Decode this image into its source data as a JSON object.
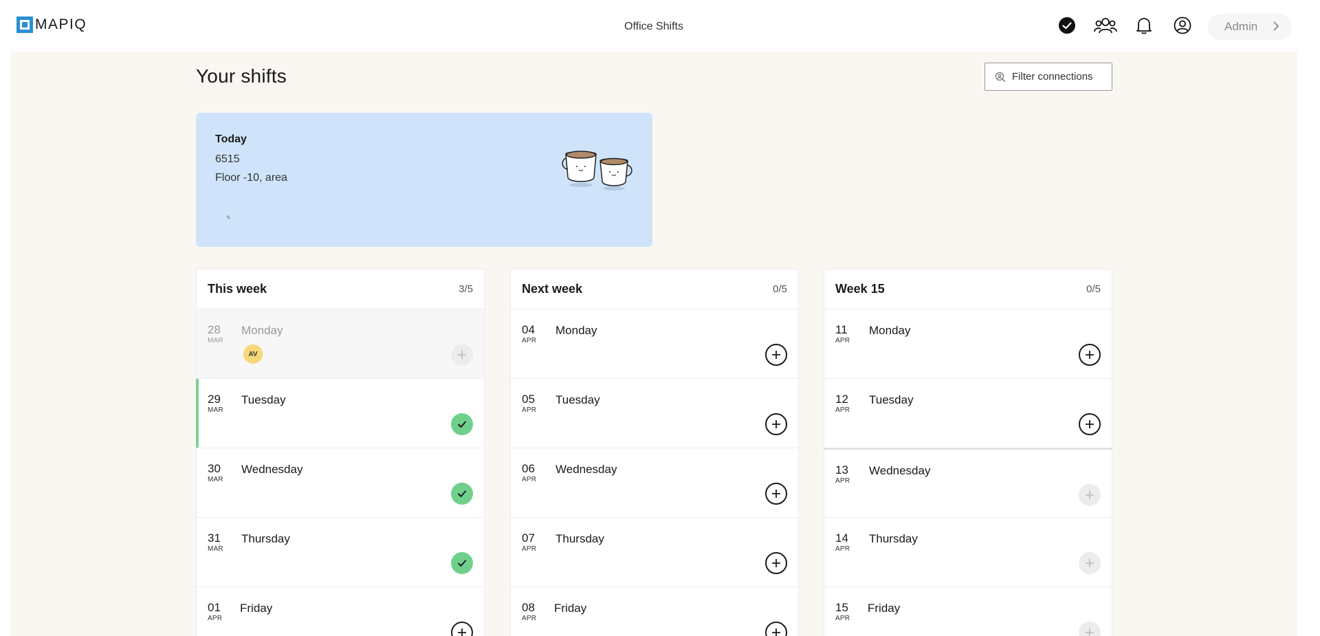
{
  "header": {
    "logo_text": "MAPIQ",
    "title": "Office Shifts",
    "icons": [
      "check-circle-icon",
      "people-icon",
      "bell-icon",
      "user-circle-icon"
    ],
    "admin_label": "Admin"
  },
  "page": {
    "title": "Your shifts",
    "filter_label": "Filter connections"
  },
  "today": {
    "label": "Today",
    "desk": "6515",
    "floor": "Floor -10, area",
    "illustration": "coffee-cups-illustration"
  },
  "weeks": [
    {
      "title": "This week",
      "count": "3/5",
      "days": [
        {
          "num": "28",
          "month": "MAR",
          "name": "Monday",
          "state": "past",
          "avatar": "AV"
        },
        {
          "num": "29",
          "month": "MAR",
          "name": "Tuesday",
          "state": "booked-today"
        },
        {
          "num": "30",
          "month": "MAR",
          "name": "Wednesday",
          "state": "booked"
        },
        {
          "num": "31",
          "month": "MAR",
          "name": "Thursday",
          "state": "booked"
        },
        {
          "num": "01",
          "month": "APR",
          "name": "Friday",
          "state": "available"
        }
      ]
    },
    {
      "title": "Next week",
      "count": "0/5",
      "days": [
        {
          "num": "04",
          "month": "APR",
          "name": "Monday",
          "state": "available"
        },
        {
          "num": "05",
          "month": "APR",
          "name": "Tuesday",
          "state": "available"
        },
        {
          "num": "06",
          "month": "APR",
          "name": "Wednesday",
          "state": "available"
        },
        {
          "num": "07",
          "month": "APR",
          "name": "Thursday",
          "state": "available"
        },
        {
          "num": "08",
          "month": "APR",
          "name": "Friday",
          "state": "available"
        }
      ]
    },
    {
      "title": "Week 15",
      "count": "0/5",
      "days": [
        {
          "num": "11",
          "month": "APR",
          "name": "Monday",
          "state": "available"
        },
        {
          "num": "12",
          "month": "APR",
          "name": "Tuesday",
          "state": "available"
        },
        {
          "num": "13",
          "month": "APR",
          "name": "Wednesday",
          "state": "unavailable"
        },
        {
          "num": "14",
          "month": "APR",
          "name": "Thursday",
          "state": "unavailable"
        },
        {
          "num": "15",
          "month": "APR",
          "name": "Friday",
          "state": "unavailable"
        }
      ]
    }
  ],
  "colors": {
    "main_bg": "#faf7f2",
    "today_card": "#cfe4fa",
    "booked_green": "#6fd08c",
    "avatar_yellow": "#f6d77a",
    "logo_blue": "#2a8fd6"
  }
}
